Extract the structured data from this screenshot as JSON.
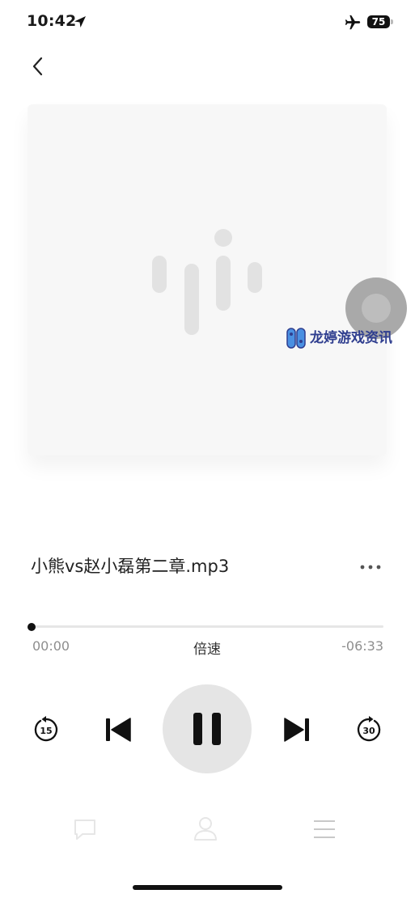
{
  "status_bar": {
    "time": "10:42",
    "battery_level": "75",
    "location_icon": "location-arrow-icon",
    "airplane_icon": "airplane-icon"
  },
  "navigation": {
    "back_icon": "chevron-left-icon"
  },
  "artwork": {
    "placeholder_icon": "audio-wave-icon"
  },
  "watermark": {
    "text": "龙婷游戏资讯"
  },
  "track": {
    "title": "小熊vs赵小磊第二章.mp3",
    "more_icon": "more-dots-icon"
  },
  "playback": {
    "elapsed": "00:00",
    "remaining": "-06:33",
    "progress": 0,
    "speed_label": "倍速",
    "rewind_seconds": "15",
    "forward_seconds": "30",
    "state": "playing"
  },
  "tabs": [
    {
      "icon": "comment-icon"
    },
    {
      "icon": "person-icon"
    },
    {
      "icon": "menu-icon"
    }
  ],
  "colors": {
    "background": "#ffffff",
    "artwork_bg": "#f7f7f7",
    "play_button_bg": "#e5e5e5",
    "watermark_text": "#2f3e8f",
    "muted_text": "#8e8e8e"
  }
}
